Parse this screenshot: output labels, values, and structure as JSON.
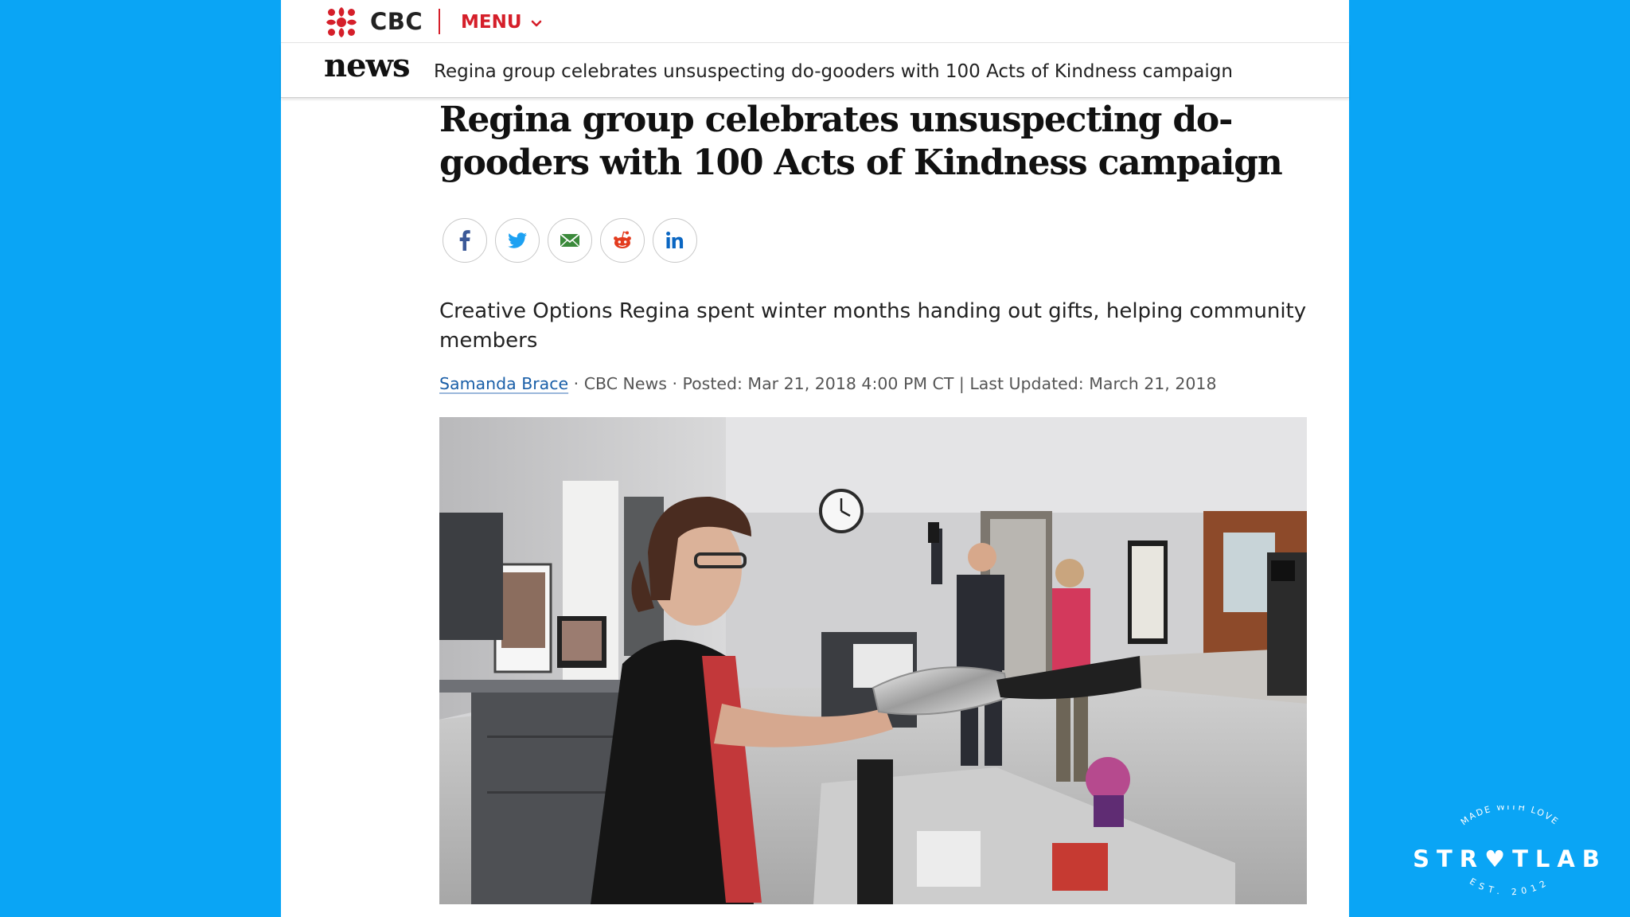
{
  "header": {
    "brand": "CBC",
    "menu_label": "MENU",
    "section": "news",
    "breadcrumb_headline": "Regina group celebrates unsuspecting do-gooders with 100 Acts of Kindness campaign"
  },
  "article": {
    "title": "Regina group celebrates unsuspecting do-gooders with 100 Acts of Kindness campaign",
    "share_buttons": [
      {
        "icon": "facebook-icon",
        "color": "#3b5998"
      },
      {
        "icon": "twitter-icon",
        "color": "#1da1f2"
      },
      {
        "icon": "email-icon",
        "color": "#3b8a3b"
      },
      {
        "icon": "reddit-icon",
        "color": "#e33b1e"
      },
      {
        "icon": "linkedin-icon",
        "color": "#0a66c2"
      }
    ],
    "deck": "Creative Options Regina spent winter months handing out gifts, helping community members",
    "author": "Samanda Brace",
    "byline_rest": " · CBC News · Posted: Mar 21, 2018 4:00 PM CT | Last Updated: March 21, 2018"
  },
  "colors": {
    "background": "#0aa5f5",
    "cbc_red": "#d51f2a",
    "link_blue": "#1a5fa8"
  },
  "watermark": {
    "arc_top": "MADE WITH LOVE",
    "word_left": "STR",
    "word_right": "TLAB",
    "arc_bottom": "EST. 2012"
  }
}
